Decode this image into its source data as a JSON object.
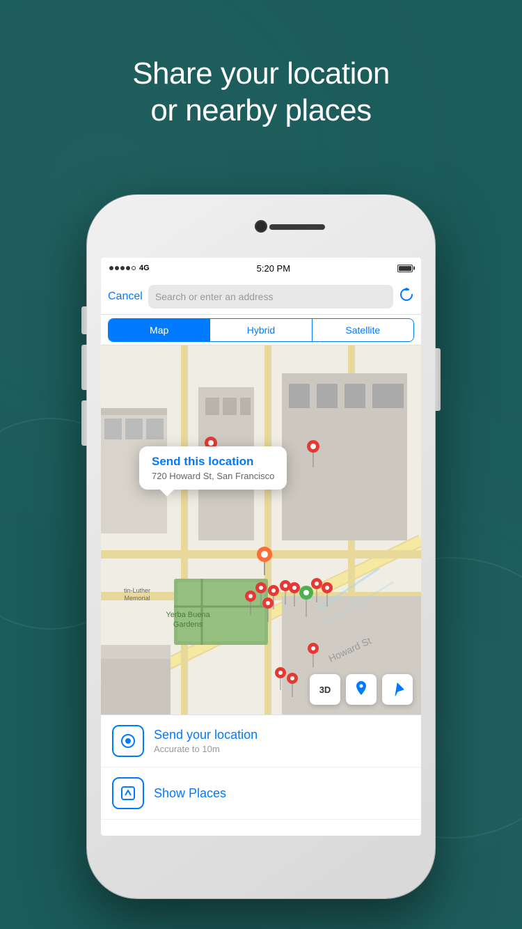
{
  "background": {
    "color": "#1a5c5a"
  },
  "header": {
    "title_line1": "Share your location",
    "title_line2": "or nearby places"
  },
  "status_bar": {
    "signal_bars": 4,
    "network": "4G",
    "time": "5:20 PM",
    "battery_full": true
  },
  "search": {
    "cancel_label": "Cancel",
    "placeholder": "Search or enter an address",
    "refresh_icon": "↻"
  },
  "map_type": {
    "options": [
      "Map",
      "Hybrid",
      "Satellite"
    ],
    "active": "Map"
  },
  "map": {
    "popup_title": "Send this location",
    "popup_address": "720 Howard St, San Francisco",
    "controls": {
      "three_d": "3D",
      "pin_icon": "📍",
      "location_icon": "➤"
    }
  },
  "actions": [
    {
      "id": "send-location",
      "icon": "●",
      "title": "Send your location",
      "subtitle": "Accurate to 10m"
    },
    {
      "id": "show-places",
      "icon": "↑",
      "title": "Show Places",
      "subtitle": ""
    }
  ]
}
